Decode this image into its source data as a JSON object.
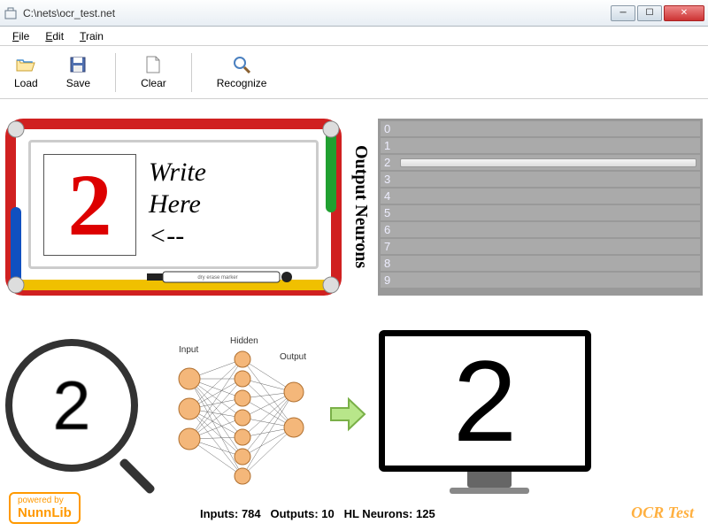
{
  "window": {
    "title": "C:\\nets\\ocr_test.net"
  },
  "menu": {
    "file": "File",
    "edit": "Edit",
    "train": "Train"
  },
  "toolbar": {
    "load": "Load",
    "save": "Save",
    "clear": "Clear",
    "recognize": "Recognize"
  },
  "whiteboard": {
    "drawn_digit": "2",
    "hint_line1": "Write",
    "hint_line2": "Here",
    "hint_line3": "<--",
    "marker_label": "dry erase marker"
  },
  "output": {
    "label": "Output Neurons",
    "neurons": [
      {
        "label": "0",
        "value": 0
      },
      {
        "label": "1",
        "value": 0
      },
      {
        "label": "2",
        "value": 100
      },
      {
        "label": "3",
        "value": 0
      },
      {
        "label": "4",
        "value": 0
      },
      {
        "label": "5",
        "value": 0
      },
      {
        "label": "6",
        "value": 0
      },
      {
        "label": "7",
        "value": 0
      },
      {
        "label": "8",
        "value": 0
      },
      {
        "label": "9",
        "value": 0
      }
    ]
  },
  "magnifier": {
    "digit": "2"
  },
  "nn": {
    "input_label": "Input",
    "hidden_label": "Hidden",
    "output_label": "Output"
  },
  "result": {
    "digit": "2"
  },
  "footer": {
    "powered_prefix": "powered by",
    "powered_name": "NunnLib",
    "status_inputs_label": "Inputs:",
    "status_inputs": "784",
    "status_outputs_label": "Outputs:",
    "status_outputs": "10",
    "status_hl_label": "HL Neurons:",
    "status_hl": "125",
    "ocr_test": "OCR Test"
  }
}
